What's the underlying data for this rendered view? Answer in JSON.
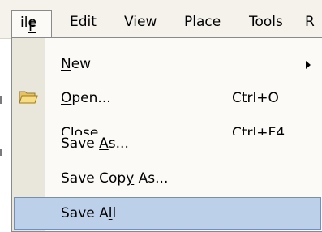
{
  "menubar": {
    "items": [
      {
        "label": "File",
        "mnemonic": "F"
      },
      {
        "label": "Edit",
        "mnemonic": "E"
      },
      {
        "label": "View",
        "mnemonic": "V"
      },
      {
        "label": "Place",
        "mnemonic": "P"
      },
      {
        "label": "Tools",
        "mnemonic": "T"
      },
      {
        "label": "R"
      }
    ]
  },
  "file_menu": {
    "new": {
      "label": "New"
    },
    "open": {
      "label": "Open...",
      "shortcut": "Ctrl+O",
      "icon": "open-folder-icon"
    },
    "close": {
      "label": "Close",
      "shortcut": "Ctrl+F4"
    },
    "save_as": {
      "label": "Save As..."
    },
    "save_copy_as": {
      "label": "Save Copy As..."
    },
    "save_all": {
      "label": "Save All"
    }
  },
  "colors": {
    "menubar_bg": "#f4f2ea",
    "menu_bg": "#fbfaf7",
    "gutter_bg": "#e9e6dc",
    "selection_bg": "#bcd0ea",
    "selection_border": "#6f8fbf"
  }
}
